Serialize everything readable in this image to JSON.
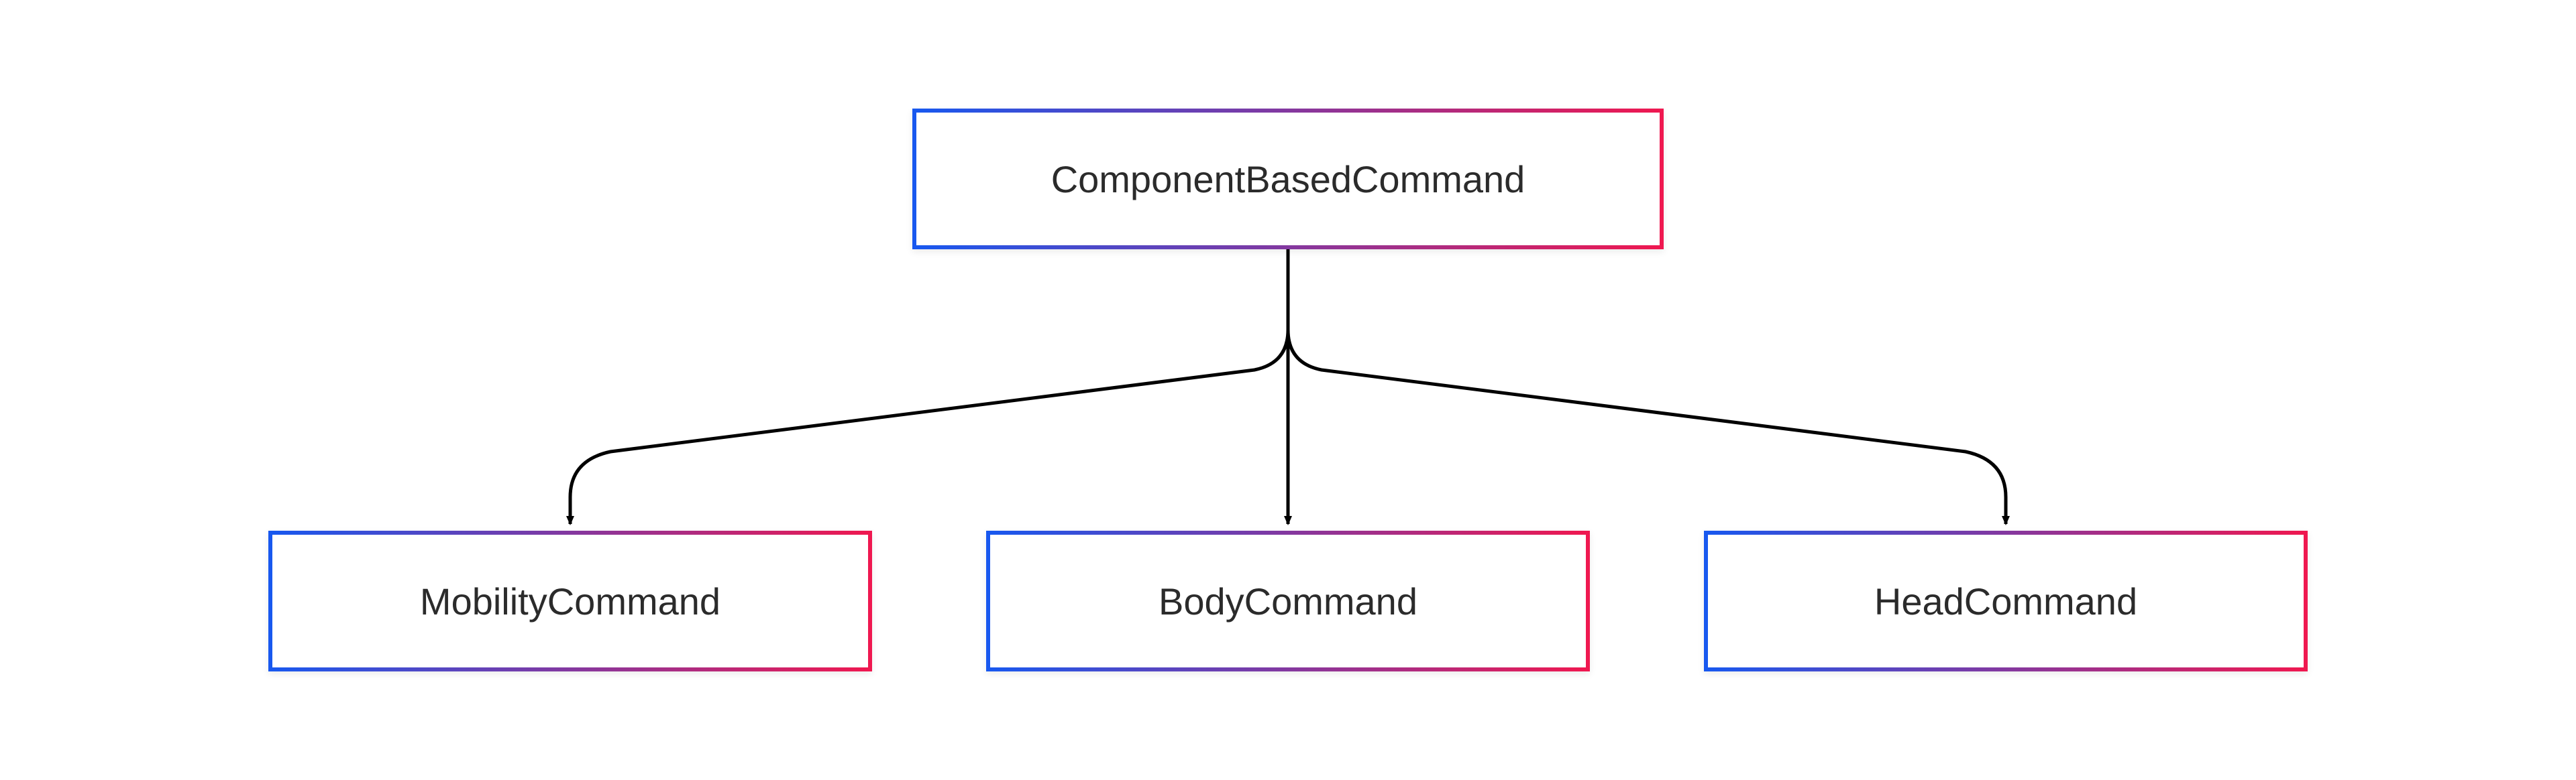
{
  "diagram": {
    "root": {
      "label": "ComponentBasedCommand"
    },
    "children": [
      {
        "label": "MobilityCommand"
      },
      {
        "label": "BodyCommand"
      },
      {
        "label": "HeadCommand"
      }
    ]
  }
}
